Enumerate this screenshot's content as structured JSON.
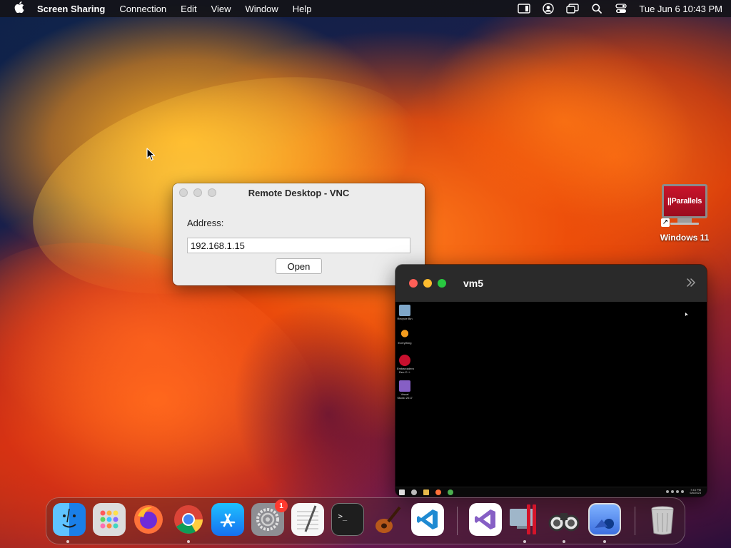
{
  "menubar": {
    "app_name": "Screen Sharing",
    "items": [
      "Connection",
      "Edit",
      "View",
      "Window",
      "Help"
    ],
    "clock": "Tue Jun 6  10:43 PM"
  },
  "vnc_dialog": {
    "title": "Remote Desktop - VNC",
    "address_label": "Address:",
    "address_value": "192.168.1.15",
    "open_label": "Open"
  },
  "desktop_icon": {
    "screen_text": "||Parallels",
    "label": "Windows 11"
  },
  "vm_window": {
    "title": "vm5",
    "desktop_icons": [
      {
        "caption": "Recycle Bin",
        "color": "#7fa7c9"
      },
      {
        "caption": "Everything",
        "color": "#f29b1d"
      },
      {
        "caption": "Embarcadero Dev-C++",
        "color": "#c8102e"
      },
      {
        "caption": "Visual Studio 2017",
        "color": "#865fc5"
      }
    ],
    "tray_time": "7:43 PM",
    "tray_date": "6/6/2023"
  },
  "dock": {
    "apps": [
      {
        "name": "Finder",
        "color": "#1e90ff"
      },
      {
        "name": "Launchpad",
        "color": "#d9d9d9"
      },
      {
        "name": "Firefox",
        "color": "#ff7139"
      },
      {
        "name": "Chrome",
        "color": "#ffffff"
      },
      {
        "name": "App Store",
        "color": "#1a8cff"
      },
      {
        "name": "System Settings",
        "color": "#8e8e93",
        "badge": "1"
      },
      {
        "name": "TextEdit",
        "color": "#f5f5f5"
      },
      {
        "name": "Terminal",
        "color": "#2b2b2b"
      },
      {
        "name": "GarageBand",
        "color": "#c96a1c"
      },
      {
        "name": "Visual Studio Code",
        "color": "#ffffff"
      },
      {
        "name": "Visual Studio",
        "color": "#ffffff"
      },
      {
        "name": "Parallels Desktop",
        "color": "#c8142a"
      },
      {
        "name": "Screen Sharing",
        "color": "#e8e8e8"
      },
      {
        "name": "Preview",
        "color": "#3c7ff0"
      },
      {
        "name": "Trash",
        "color": "#bfbfbf"
      }
    ]
  }
}
